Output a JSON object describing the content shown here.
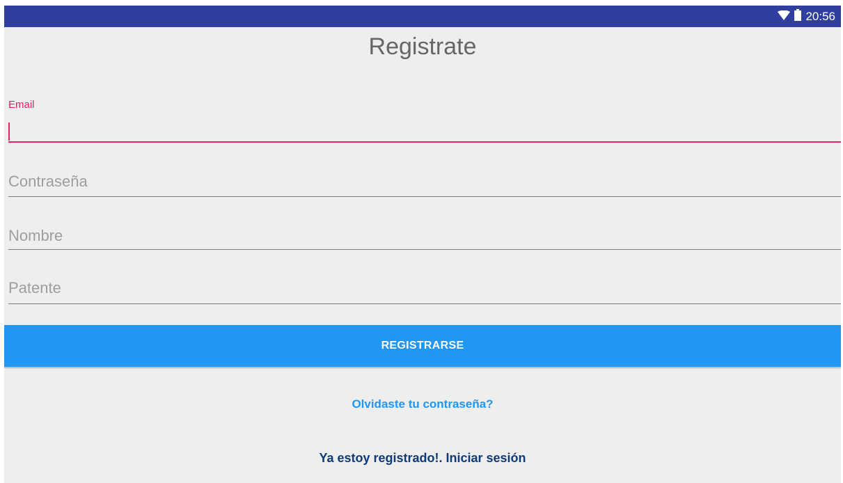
{
  "status_bar": {
    "time": "20:56",
    "icons": [
      "wifi-icon",
      "battery-icon"
    ],
    "background": "#303f9f"
  },
  "page": {
    "title": "Registrate"
  },
  "form": {
    "email": {
      "label": "Email",
      "value": ""
    },
    "password": {
      "placeholder": "Contraseña",
      "value": ""
    },
    "name": {
      "placeholder": "Nombre",
      "value": ""
    },
    "plate": {
      "placeholder": "Patente",
      "value": ""
    }
  },
  "actions": {
    "register_label": "REGISTRARSE",
    "forgot_password_label": "Olvidaste tu contraseña?",
    "login_label": "Ya estoy registrado!. Iniciar sesión"
  },
  "colors": {
    "accent": "#e91e63",
    "primary": "#2196f3",
    "link_dark": "#0d3b7a",
    "background": "#eeeeee"
  }
}
